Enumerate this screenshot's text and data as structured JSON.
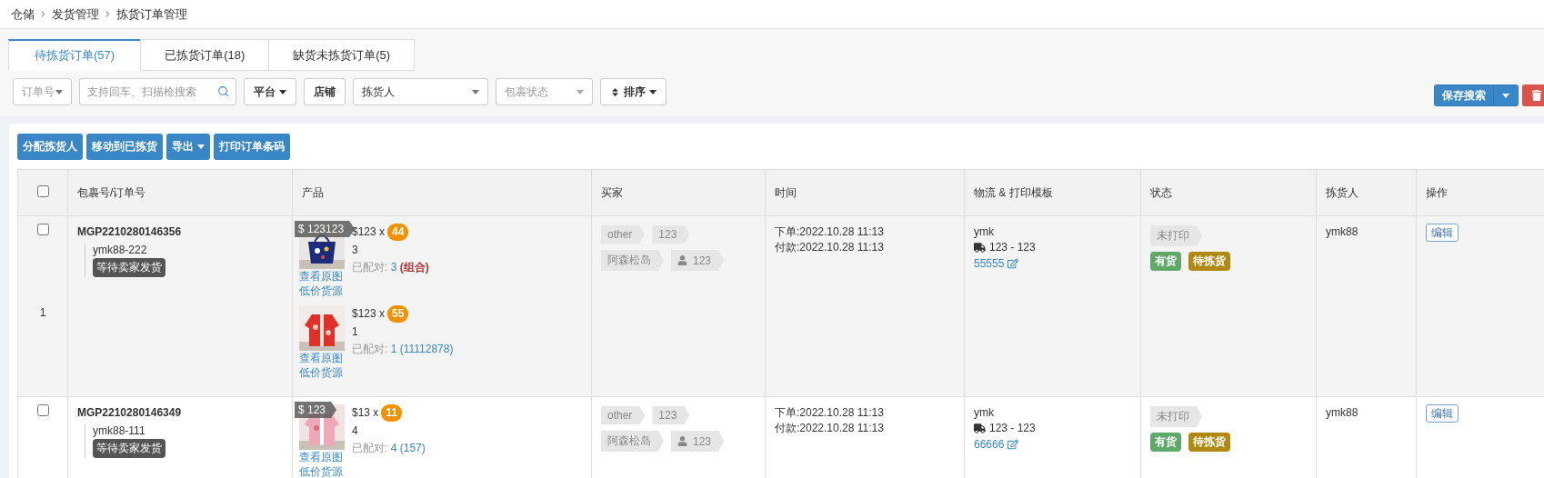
{
  "breadcrumb": [
    "仓储",
    "发货管理",
    "拣货订单管理"
  ],
  "tabs": [
    {
      "label": "待拣货订单(57)",
      "selected": true
    },
    {
      "label": "已拣货订单(18)",
      "selected": false
    },
    {
      "label": "缺货未拣货订单(5)",
      "selected": false
    }
  ],
  "filters": {
    "order_field": "订单号",
    "search": {
      "placeholder": "支持回车、扫描枪搜索"
    },
    "platform": "平台",
    "shop": "店铺",
    "picker": "拣货人",
    "package_status": {
      "placeholder": "包裹状态"
    },
    "sort": "排序"
  },
  "save_search": "保存搜索",
  "actions": [
    {
      "label": "分配拣货人",
      "kind": "button"
    },
    {
      "label": "移动到已拣货",
      "kind": "button"
    },
    {
      "label": "导出",
      "kind": "dropdown"
    },
    {
      "label": "打印订单条码",
      "kind": "button"
    }
  ],
  "table": {
    "select_all_checked": false,
    "columns": [
      "包裹号/订单号",
      "产品",
      "买家",
      "时间",
      "物流 & 打印模板",
      "状态",
      "拣货人",
      "操作"
    ],
    "rows": [
      {
        "checked": false,
        "index": "1",
        "package_no": "MGP2210280146356",
        "order_no": "ymk88-222",
        "order_status": "等待卖家发货",
        "products": [
          {
            "price_tag": "$ 123123",
            "price": "$123 x",
            "quantity_badge": "44",
            "quantity": "3",
            "matched_label": "已配对:",
            "matched_count": "3",
            "matched_extra": {
              "text": "(组合)",
              "kind": "combo"
            },
            "links": [
              "查看原图",
              "低价货源"
            ]
          },
          {
            "price": "$123 x",
            "quantity_badge": "55",
            "quantity": "1",
            "matched_label": "已配对:",
            "matched_count": "1",
            "matched_extra": {
              "text": "(11112878)",
              "kind": "ref"
            },
            "links": [
              "查看原图",
              "低价货源"
            ]
          }
        ],
        "buyer": {
          "tags": [
            "other",
            "123"
          ],
          "region": "阿森松岛",
          "user": "123"
        },
        "time": [
          "下单:2022.10.28 11:13",
          "付款:2022.10.28 11:13"
        ],
        "logistics": {
          "carrier": "ymk",
          "route": "123 - 123",
          "template": "55555"
        },
        "status": {
          "print": "未打印",
          "badges": [
            {
              "label": "有货",
              "color": "#5fa86a"
            },
            {
              "label": "待拣货",
              "color": "#b08a10"
            }
          ]
        },
        "picker": "ymk88",
        "action": "编辑"
      },
      {
        "checked": false,
        "package_no": "MGP2210280146349",
        "order_no": "ymk88-111",
        "order_status": "等待卖家发货",
        "products": [
          {
            "price_tag": "$ 123",
            "price": "$13 x",
            "quantity_badge": "11",
            "quantity": "4",
            "matched_label": "已配对:",
            "matched_count": "4",
            "matched_extra": {
              "text": "(157)",
              "kind": "ref"
            },
            "links": [
              "查看原图",
              "低价货源"
            ]
          }
        ],
        "buyer": {
          "tags": [
            "other",
            "123"
          ],
          "region": "阿森松岛",
          "user": "123"
        },
        "time": [
          "下单:2022.10.28 11:13",
          "付款:2022.10.28 11:13"
        ],
        "logistics": {
          "carrier": "ymk",
          "route": "123 - 123",
          "template": "66666"
        },
        "status": {
          "print": "未打印",
          "badges": [
            {
              "label": "有货",
              "color": "#5fa86a"
            },
            {
              "label": "待拣货",
              "color": "#b08a10"
            }
          ]
        },
        "picker": "ymk88",
        "action": "编辑"
      }
    ]
  }
}
